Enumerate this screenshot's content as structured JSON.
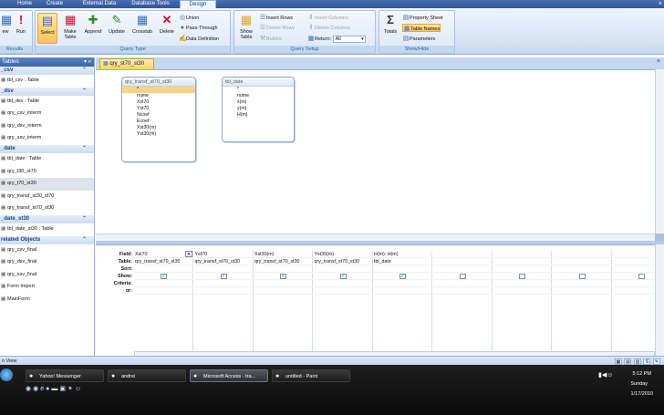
{
  "ribbon_tabs": [
    "Home",
    "Create",
    "External Data",
    "Database Tools",
    "Design"
  ],
  "ribbon_active_tab": "Design",
  "ribbon": {
    "results": {
      "label": "Results",
      "view": "ew",
      "run": "Run"
    },
    "query_type": {
      "label": "Query Type",
      "select": "Select",
      "make_table": "Make Table",
      "append": "Append",
      "update": "Update",
      "crosstab": "Crosstab",
      "delete": "Delete",
      "union": "Union",
      "pass_through": "Pass-Through",
      "data_definition": "Data Definition"
    },
    "query_setup": {
      "label": "Query Setup",
      "show_table": "Show Table",
      "insert_rows": "Insert Rows",
      "delete_rows": "Delete Rows",
      "builder": "Builder",
      "insert_columns": "Insert Columns",
      "delete_columns": "Delete Columns",
      "return_label": "Return:",
      "return_value": "All"
    },
    "show_hide": {
      "label": "Show/Hide",
      "totals": "Totals",
      "property_sheet": "Property Sheet",
      "table_names": "Table Names",
      "parameters": "Parameters"
    }
  },
  "nav": {
    "header": "Tables",
    "groups": [
      {
        "name": "_csv",
        "items": [
          "tbl_csv : Table"
        ]
      },
      {
        "name": "_dsv",
        "items": [
          "tbl_dsv : Table",
          "qry_csv_interm",
          "qry_dsv_interm",
          "qry_ssv_interm"
        ]
      },
      {
        "name": "_date",
        "items": [
          "tbl_date : Table",
          "qry_t30_st70",
          "qry_t70_st30",
          "qry_transf_st30_st70",
          "qry_transf_st70_st30"
        ]
      },
      {
        "name": "_date_st30",
        "items": [
          "tbl_date_st30 : Table"
        ]
      },
      {
        "name": "related Objects",
        "items": [
          "qry_csv_final",
          "qry_dsv_final",
          "qry_ssv_final",
          "Form Import",
          "MainForm"
        ]
      }
    ]
  },
  "document": {
    "tab_label": "qry_st70_st30",
    "field_lists": [
      {
        "title": "qry_transf_st70_st30",
        "fields": [
          "*",
          "nume",
          "Xst70",
          "Yst70",
          "Ncoef",
          "Ecoef",
          "Xst30(m)",
          "Yst30(m)"
        ]
      },
      {
        "title": "tbl_date",
        "fields": [
          "*",
          "nume",
          "x(m)",
          "y(m)",
          "H(m)"
        ]
      }
    ],
    "grid_row_labels": [
      "Field:",
      "Table:",
      "Sort:",
      "Show:",
      "Criteria:",
      "or:"
    ],
    "grid_columns": [
      {
        "field": "Xst70",
        "table": "qry_transf_st70_st30",
        "show": true
      },
      {
        "field": "Yst70",
        "table": "qry_transf_st70_st30",
        "show": true
      },
      {
        "field": "Xst30(m)",
        "table": "qry_transf_st70_st30",
        "show": true
      },
      {
        "field": "Yst30(m)",
        "table": "qry_transf_st70_st30",
        "show": true
      },
      {
        "field": "H(m): H(m)",
        "table": "tbl_date",
        "show": true
      },
      {
        "field": "",
        "table": "",
        "show": false
      },
      {
        "field": "",
        "table": "",
        "show": false
      },
      {
        "field": "",
        "table": "",
        "show": false
      },
      {
        "field": "",
        "table": "",
        "show": false
      }
    ]
  },
  "statusbar": {
    "text": "n View"
  },
  "taskbar": {
    "tasks": [
      {
        "label": "Yahoo! Messenger",
        "icon": "yahoo-icon"
      },
      {
        "label": "andrei",
        "icon": "folder-icon"
      },
      {
        "label": "Microsoft Access - tra...",
        "icon": "access-icon",
        "active": true
      },
      {
        "label": "untitled - Paint",
        "icon": "paint-icon"
      }
    ],
    "clock": {
      "time": "5:12 PM",
      "day": "Sunday",
      "date": "1/17/2010"
    }
  }
}
